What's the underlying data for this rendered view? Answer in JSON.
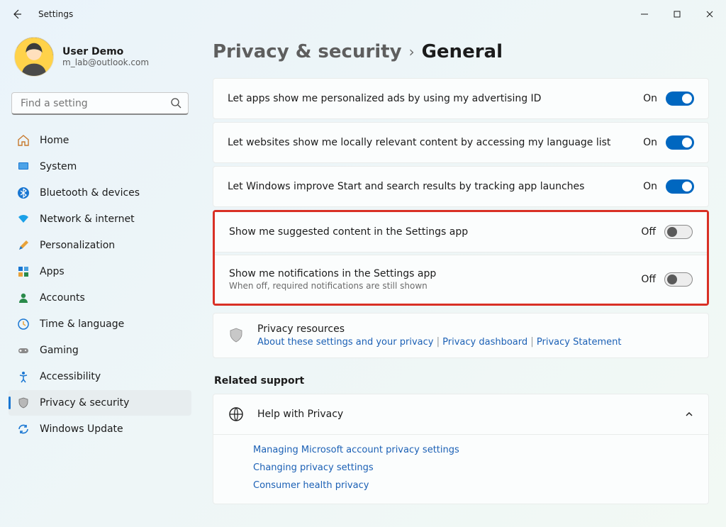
{
  "app_title": "Settings",
  "user": {
    "name": "User Demo",
    "email": "m_lab@outlook.com"
  },
  "search": {
    "placeholder": "Find a setting"
  },
  "sidebar": {
    "items": [
      {
        "label": "Home"
      },
      {
        "label": "System"
      },
      {
        "label": "Bluetooth & devices"
      },
      {
        "label": "Network & internet"
      },
      {
        "label": "Personalization"
      },
      {
        "label": "Apps"
      },
      {
        "label": "Accounts"
      },
      {
        "label": "Time & language"
      },
      {
        "label": "Gaming"
      },
      {
        "label": "Accessibility"
      },
      {
        "label": "Privacy & security"
      },
      {
        "label": "Windows Update"
      }
    ]
  },
  "breadcrumb": {
    "parent": "Privacy & security",
    "current": "General"
  },
  "settings": [
    {
      "label": "Let apps show me personalized ads by using my advertising ID",
      "state_label": "On",
      "state": "on"
    },
    {
      "label": "Let websites show me locally relevant content by accessing my language list",
      "state_label": "On",
      "state": "on"
    },
    {
      "label": "Let Windows improve Start and search results by tracking app launches",
      "state_label": "On",
      "state": "on"
    },
    {
      "label": "Show me suggested content in the Settings app",
      "state_label": "Off",
      "state": "off"
    },
    {
      "label": "Show me notifications in the Settings app",
      "sub": "When off, required notifications are still shown",
      "state_label": "Off",
      "state": "off"
    }
  ],
  "resources": {
    "title": "Privacy resources",
    "links": [
      "About these settings and your privacy",
      "Privacy dashboard",
      "Privacy Statement"
    ]
  },
  "related_support_label": "Related support",
  "help": {
    "title": "Help with Privacy",
    "links": [
      "Managing Microsoft account privacy settings",
      "Changing privacy settings",
      "Consumer health privacy"
    ]
  }
}
